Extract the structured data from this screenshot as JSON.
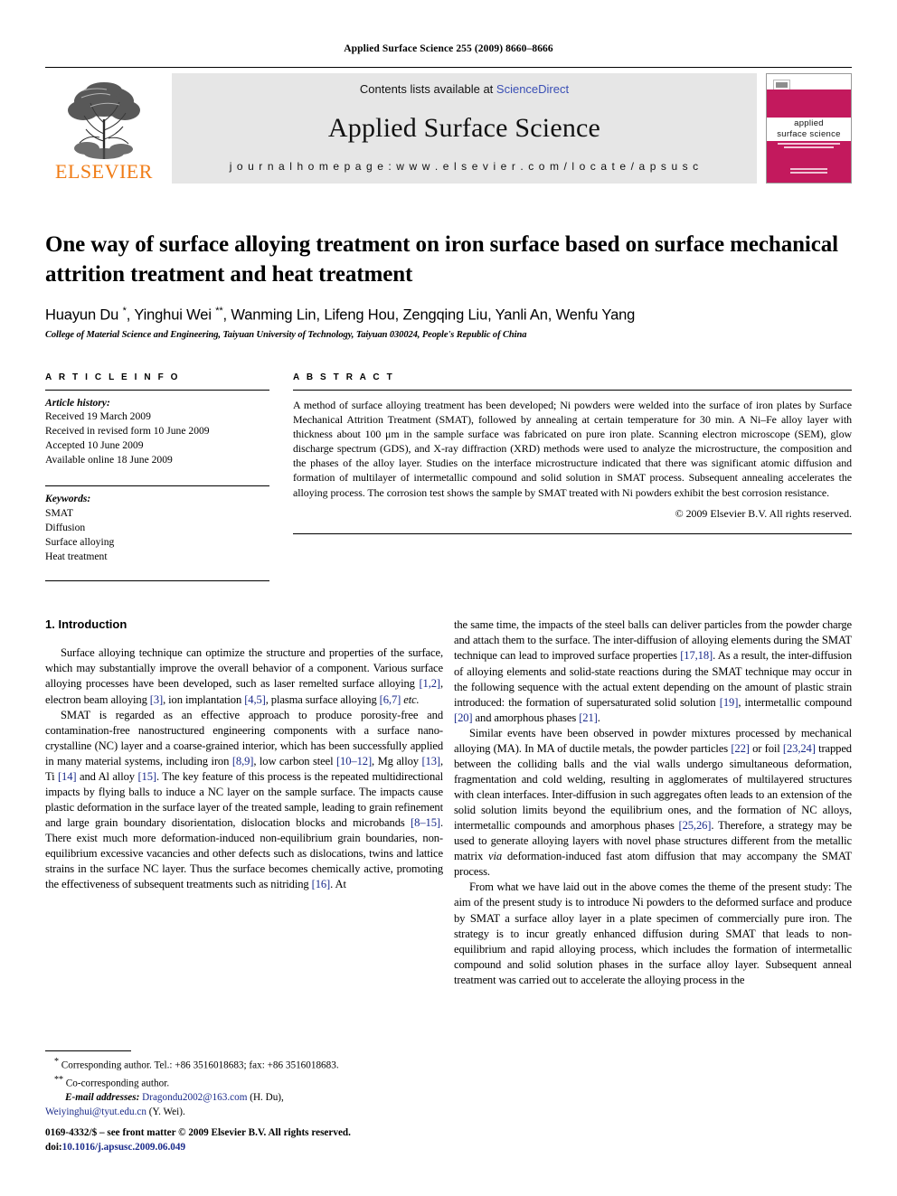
{
  "running_head": "Applied Surface Science 255 (2009) 8660–8666",
  "banner": {
    "publisher_name": "ELSEVIER",
    "contents_prefix": "Contents lists available at ",
    "sciencedirect": "ScienceDirect",
    "journal_title": "Applied Surface Science",
    "homepage": "j o u r n a l  h o m e p a g e :  w w w . e l s e v i e r . c o m / l o c a t e / a p s u s c",
    "cover_title_line1": "applied",
    "cover_title_line2": "surface science",
    "accent_color": "#C3195D",
    "elsevier_orange": "#F07C16",
    "link_blue": "#3a4fb5"
  },
  "article": {
    "title": "One way of surface alloying treatment on iron surface based on surface mechanical attrition treatment and heat treatment",
    "authors": "Huayun Du *, Yinghui Wei **, Wanming Lin, Lifeng Hou, Zengqing Liu, Yanli An, Wenfu Yang",
    "affiliation": "College of Material Science and Engineering, Taiyuan University of Technology, Taiyuan 030024, People's Republic of China"
  },
  "info": {
    "heading": "A R T I C L E   I N F O",
    "history_label": "Article history:",
    "history": [
      "Received 19 March 2009",
      "Received in revised form 10 June 2009",
      "Accepted 10 June 2009",
      "Available online 18 June 2009"
    ],
    "keywords_label": "Keywords:",
    "keywords": [
      "SMAT",
      "Diffusion",
      "Surface alloying",
      "Heat treatment"
    ]
  },
  "abstract": {
    "heading": "A B S T R A C T",
    "text": "A method of surface alloying treatment has been developed; Ni powders were welded into the surface of iron plates by Surface Mechanical Attrition Treatment (SMAT), followed by annealing at certain temperature for 30 min. A Ni–Fe alloy layer with thickness about 100 μm in the sample surface was fabricated on pure iron plate. Scanning electron microscope (SEM), glow discharge spectrum (GDS), and X-ray diffraction (XRD) methods were used to analyze the microstructure, the composition and the phases of the alloy layer. Studies on the interface microstructure indicated that there was significant atomic diffusion and formation of multilayer of intermetallic compound and solid solution in SMAT process. Subsequent annealing accelerates the alloying process. The corrosion test shows the sample by SMAT treated with Ni powders exhibit the best corrosion resistance.",
    "copyright": "© 2009 Elsevier B.V. All rights reserved."
  },
  "introduction": {
    "heading": "1.  Introduction",
    "left_paragraphs": [
      "Surface alloying technique can optimize the structure and properties of the surface, which may substantially improve the overall behavior of a component. Various surface alloying processes have been developed, such as laser remelted surface alloying [1,2], electron beam alloying [3], ion implantation [4,5], plasma surface alloying [6,7] etc.",
      "SMAT is regarded as an effective approach to produce porosity-free and contamination-free nanostructured engineering components with a surface nano-crystalline (NC) layer and a coarse-grained interior, which has been successfully applied in many material systems, including iron [8,9], low carbon steel [10–12], Mg alloy [13], Ti [14] and Al alloy [15]. The key feature of this process is the repeated multidirectional impacts by flying balls to induce a NC layer on the sample surface. The impacts cause plastic deformation in the surface layer of the treated sample, leading to grain refinement and large grain boundary disorientation, dislocation blocks and microbands [8–15]. There exist much more deformation-induced non-equilibrium grain boundaries, non-equilibrium excessive vacancies and other defects such as dislocations, twins and lattice strains in the surface NC layer. Thus the surface becomes chemically active, promoting the effectiveness of subsequent treatments such as nitriding [16]. At"
    ],
    "right_paragraphs": [
      "the same time, the impacts of the steel balls can deliver particles from the powder charge and attach them to the surface. The inter-diffusion of alloying elements during the SMAT technique can lead to improved surface properties [17,18]. As a result, the inter-diffusion of alloying elements and solid-state reactions during the SMAT technique may occur in the following sequence with the actual extent depending on the amount of plastic strain introduced: the formation of supersaturated solid solution [19], intermetallic compound [20] and amorphous phases [21].",
      "Similar events have been observed in powder mixtures processed by mechanical alloying (MA). In MA of ductile metals, the powder particles [22] or foil [23,24] trapped between the colliding balls and the vial walls undergo simultaneous deformation, fragmentation and cold welding, resulting in agglomerates of multilayered structures with clean interfaces. Inter-diffusion in such aggregates often leads to an extension of the solid solution limits beyond the equilibrium ones, and the formation of NC alloys, intermetallic compounds and amorphous phases [25,26]. Therefore, a strategy may be used to generate alloying layers with novel phase structures different from the metallic matrix via deformation-induced fast atom diffusion that may accompany the SMAT process.",
      "From what we have laid out in the above comes the theme of the present study: The aim of the present study is to introduce Ni powders to the deformed surface and produce by SMAT a surface alloy layer in a plate specimen of commercially pure iron. The strategy is to incur greatly enhanced diffusion during SMAT that leads to non-equilibrium and rapid alloying process, which includes the formation of intermetallic compound and solid solution phases in the surface alloy layer. Subsequent anneal treatment was carried out to accelerate the alloying process in the"
    ]
  },
  "footnotes": {
    "corresponding": "Corresponding author. Tel.: +86 3516018683; fax: +86 3516018683.",
    "cocorresponding": "Co-corresponding author.",
    "email_label": "E-mail addresses:",
    "email1": "Dragondu2002@163.com",
    "email1_owner": "(H. Du),",
    "email2": "Weiyinghui@tyut.edu.cn",
    "email2_owner": "(Y. Wei)."
  },
  "page_footer": {
    "line1": "0169-4332/$ – see front matter © 2009 Elsevier B.V. All rights reserved.",
    "doi_label": "doi:",
    "doi_value": "10.1016/j.apsusc.2009.06.049"
  }
}
